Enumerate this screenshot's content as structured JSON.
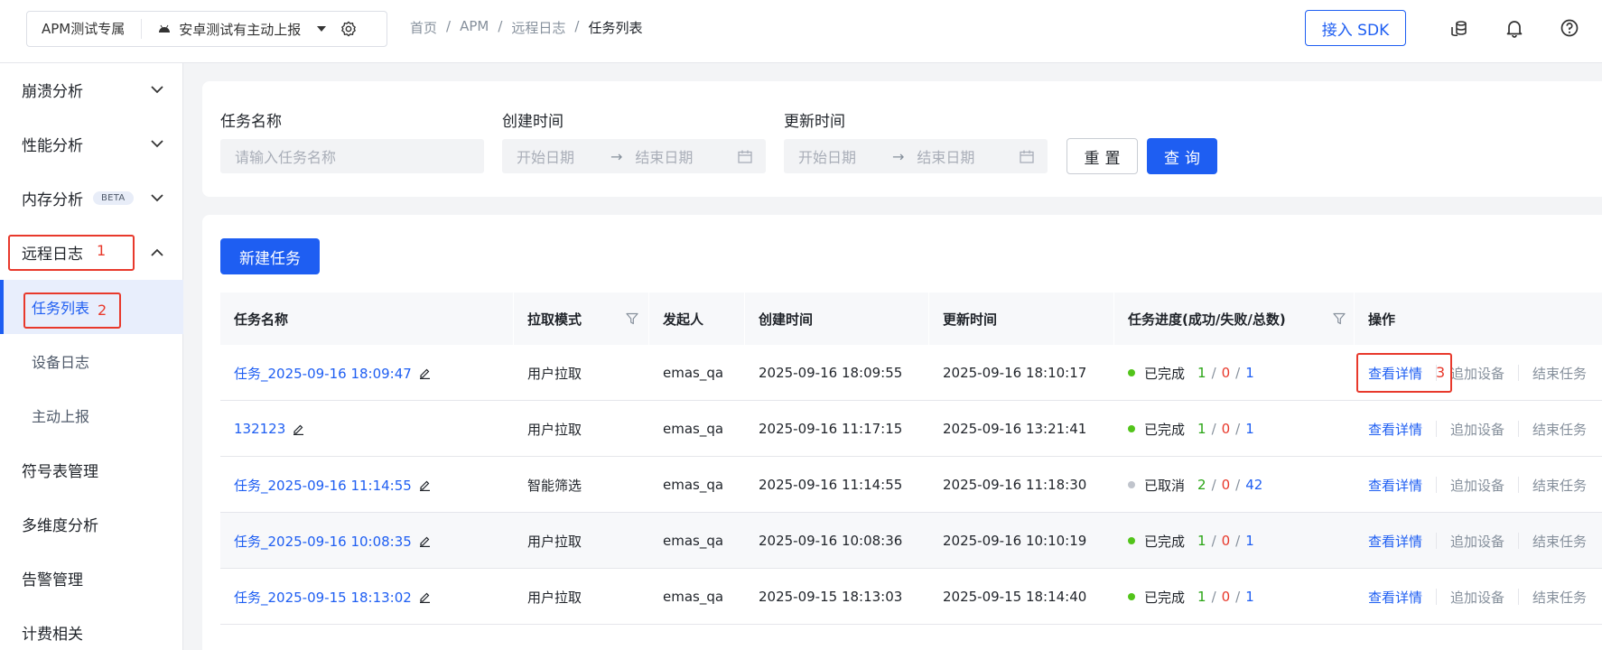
{
  "header": {
    "app_name": "APM测试专属",
    "project_name": "安卓测试有主动上报",
    "breadcrumb": [
      "首页",
      "APM",
      "远程日志",
      "任务列表"
    ],
    "breadcrumb_sep": "/",
    "sdk_button": "接入 SDK",
    "icons": [
      "android-icon",
      "caret-down-icon",
      "gear-icon",
      "coins-icon",
      "bell-icon",
      "help-icon"
    ]
  },
  "sidebar": {
    "items": [
      {
        "label": "崩溃分析",
        "expandable": true
      },
      {
        "label": "性能分析",
        "expandable": true
      },
      {
        "label": "内存分析",
        "badge": "BETA",
        "expandable": true
      },
      {
        "label": "远程日志",
        "expanded": true,
        "annotation": "1"
      },
      {
        "label": "符号表管理"
      },
      {
        "label": "多维度分析"
      },
      {
        "label": "告警管理"
      },
      {
        "label": "计费相关"
      }
    ],
    "subitems": [
      {
        "label": "任务列表",
        "active": true,
        "annotation": "2"
      },
      {
        "label": "设备日志"
      },
      {
        "label": "主动上报"
      }
    ]
  },
  "filters": {
    "task_name_label": "任务名称",
    "task_name_placeholder": "请输入任务名称",
    "created_label": "创建时间",
    "updated_label": "更新时间",
    "start_placeholder": "开始日期",
    "end_placeholder": "结束日期",
    "range_arrow": "→",
    "reset": "重置",
    "query": "查询"
  },
  "table": {
    "new_task": "新建任务",
    "columns": [
      "任务名称",
      "拉取模式",
      "发起人",
      "创建时间",
      "更新时间",
      "任务进度(成功/失败/总数)",
      "操作"
    ],
    "rows": [
      {
        "name": "任务_2025-09-16 18:09:47",
        "mode": "用户拉取",
        "creator": "emas_qa",
        "created": "2025-09-16 18:09:55",
        "updated": "2025-09-16 18:10:17",
        "status": "已完成",
        "status_color": "#52c41a",
        "success": "1",
        "fail": "0",
        "total": "1"
      },
      {
        "name": "132123",
        "mode": "用户拉取",
        "creator": "emas_qa",
        "created": "2025-09-16 11:17:15",
        "updated": "2025-09-16 13:21:41",
        "status": "已完成",
        "status_color": "#52c41a",
        "success": "1",
        "fail": "0",
        "total": "1"
      },
      {
        "name": "任务_2025-09-16 11:14:55",
        "mode": "智能筛选",
        "creator": "emas_qa",
        "created": "2025-09-16 11:14:55",
        "updated": "2025-09-16 11:18:30",
        "status": "已取消",
        "status_color": "#c0c4cc",
        "success": "2",
        "fail": "0",
        "total": "42"
      },
      {
        "name": "任务_2025-09-16 10:08:35",
        "mode": "用户拉取",
        "creator": "emas_qa",
        "created": "2025-09-16 10:08:36",
        "updated": "2025-09-16 10:10:19",
        "status": "已完成",
        "status_color": "#52c41a",
        "success": "1",
        "fail": "0",
        "total": "1"
      },
      {
        "name": "任务_2025-09-15 18:13:02",
        "mode": "用户拉取",
        "creator": "emas_qa",
        "created": "2025-09-15 18:13:03",
        "updated": "2025-09-15 18:14:40",
        "status": "已完成",
        "status_color": "#52c41a",
        "success": "1",
        "fail": "0",
        "total": "1"
      }
    ],
    "actions": {
      "detail": "查看详情",
      "add_device": "追加设备",
      "end_task": "结束任务"
    },
    "detail_annotation": "3"
  },
  "colors": {
    "accent": "#1e5ef2",
    "annotation": "#e8392c",
    "success": "#2aa515"
  }
}
